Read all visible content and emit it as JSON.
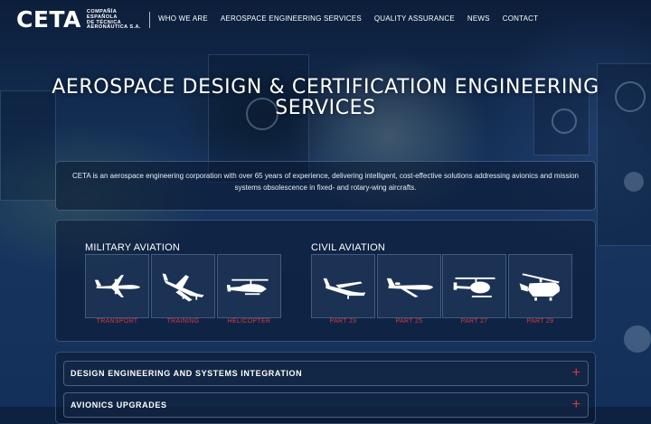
{
  "brand": {
    "name": "CETA",
    "subtitle_lines": [
      "COMPAÑÍA",
      "ESPAÑOLA",
      "DE TÉCNICA",
      "AERONÁUTICA S.A."
    ]
  },
  "nav": {
    "items": [
      "WHO WE ARE",
      "AEROSPACE ENGINEERING SERVICES",
      "QUALITY ASSURANCE",
      "NEWS",
      "CONTACT"
    ]
  },
  "hero": {
    "title": "AEROSPACE DESIGN & CERTIFICATION ENGINEERING SERVICES",
    "intro": "CETA is an aerospace engineering corporation with over 65 years of experience, delivering intelligent, cost-effective solutions addressing avionics and mission systems obsolescence in fixed- and rotary-wing aircrafts."
  },
  "aviation": {
    "military": {
      "title": "MILITARY AVIATION",
      "tiles": [
        {
          "label": "TRANSPORT",
          "icon": "transport-plane-icon"
        },
        {
          "label": "TRAINING",
          "icon": "training-plane-icon"
        },
        {
          "label": "HELICOPTER",
          "icon": "attack-helicopter-icon"
        }
      ]
    },
    "civil": {
      "title": "CIVIL AVIATION",
      "tiles": [
        {
          "label": "PART 23",
          "icon": "light-aircraft-icon"
        },
        {
          "label": "PART 25",
          "icon": "jet-aircraft-icon"
        },
        {
          "label": "PART 27",
          "icon": "light-helicopter-icon"
        },
        {
          "label": "PART 29",
          "icon": "heavy-helicopter-icon"
        }
      ]
    }
  },
  "sections": [
    {
      "label": "DESIGN ENGINEERING AND SYSTEMS INTEGRATION",
      "toggle": "+"
    },
    {
      "label": "AVIONICS UPGRADES",
      "toggle": "+"
    }
  ],
  "colors": {
    "accent": "#d83a3a",
    "background": "#13305a"
  }
}
